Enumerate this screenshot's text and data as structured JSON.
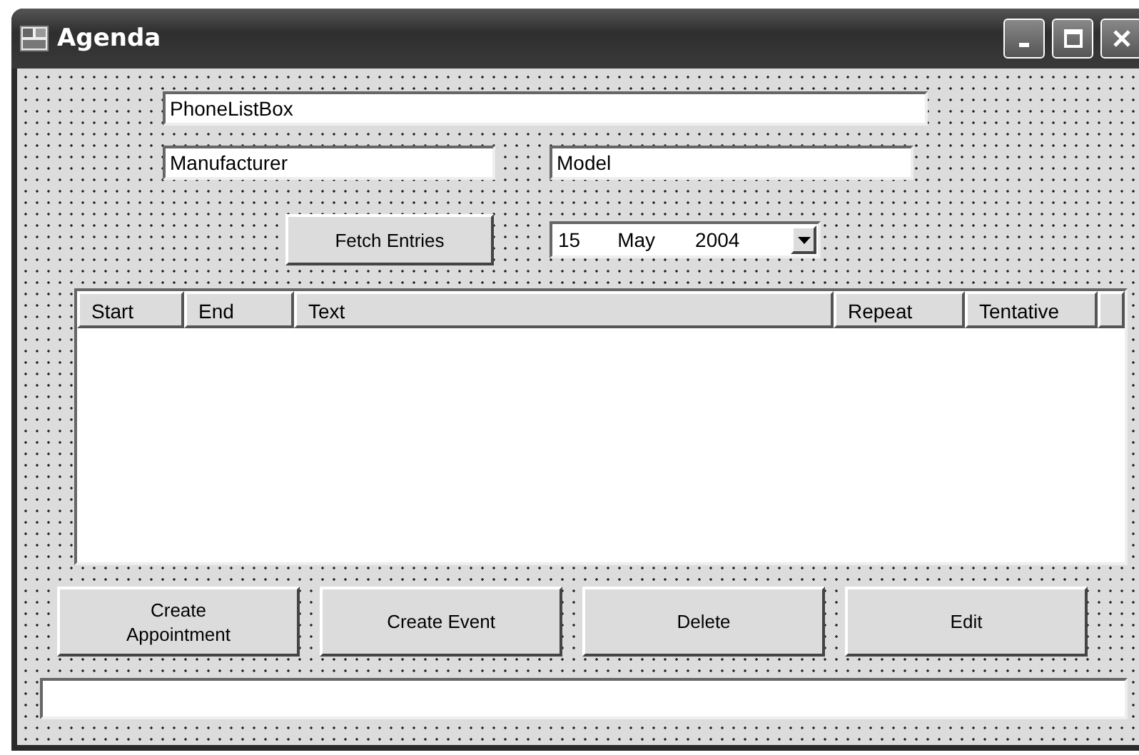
{
  "window": {
    "title": "Agenda"
  },
  "phone_list_box": {
    "value": "PhoneListBox"
  },
  "manufacturer_field": {
    "value": "Manufacturer"
  },
  "model_field": {
    "value": "Model"
  },
  "fetch_button": {
    "label": "Fetch Entries"
  },
  "date_picker": {
    "day": "15",
    "month": "May",
    "year": "2004"
  },
  "list": {
    "columns": [
      {
        "label": "Start"
      },
      {
        "label": "End"
      },
      {
        "label": "Text"
      },
      {
        "label": "Repeat"
      },
      {
        "label": "Tentative"
      }
    ]
  },
  "buttons": [
    {
      "label": "Create Appointment"
    },
    {
      "label": "Create Event"
    },
    {
      "label": "Delete"
    },
    {
      "label": "Edit"
    }
  ]
}
